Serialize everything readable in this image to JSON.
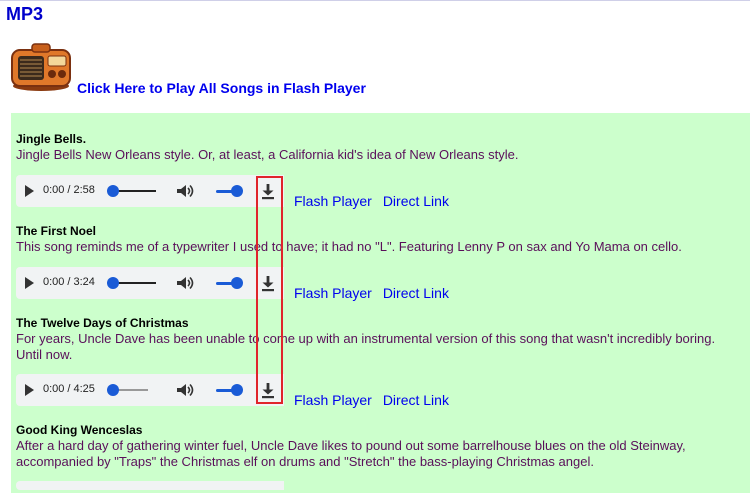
{
  "page": {
    "title": "MP3",
    "play_all_link": "Click Here to Play All Songs in Flash Player"
  },
  "songs": [
    {
      "title": "Jingle Bells.",
      "description": "Jingle Bells New Orleans style. Or, at least, a California kid's idea of New Orleans style.",
      "player": {
        "current_time": "0:00",
        "separator": "/",
        "duration": "2:58"
      },
      "links": {
        "flash": "Flash Player",
        "direct": "Direct Link"
      }
    },
    {
      "title": "The First Noel",
      "description": "This song reminds me of a typewriter I used to have; it had no \"L\". Featuring Lenny P on sax and Yo Mama on cello.",
      "player": {
        "current_time": "0:00",
        "separator": "/",
        "duration": "3:24"
      },
      "links": {
        "flash": "Flash Player",
        "direct": "Direct Link"
      }
    },
    {
      "title": "The Twelve Days of Christmas",
      "description": "For years, Uncle Dave has been unable to come up with an instrumental version of this song that wasn't incredibly boring. Until now.",
      "player": {
        "current_time": "0:00",
        "separator": "/",
        "duration": "4:25"
      },
      "links": {
        "flash": "Flash Player",
        "direct": "Direct Link"
      }
    },
    {
      "title": "Good King Wenceslas",
      "description": "After a hard day of gathering winter fuel, Uncle Dave likes to pound out some barrelhouse blues on the old Steinway, accompanied by \"Traps\" the Christmas elf on drums and \"Stretch\" the bass-playing Christmas angel."
    }
  ],
  "colors": {
    "panel_background": "#ccffcc",
    "link": "#0000ee",
    "description_text": "#5a0f5a",
    "player_accent": "#1a5bd6",
    "highlight": "#e0242b"
  },
  "icons": {
    "play": "play-icon",
    "volume": "volume-icon",
    "download": "download-icon",
    "radio": "radio-icon"
  }
}
